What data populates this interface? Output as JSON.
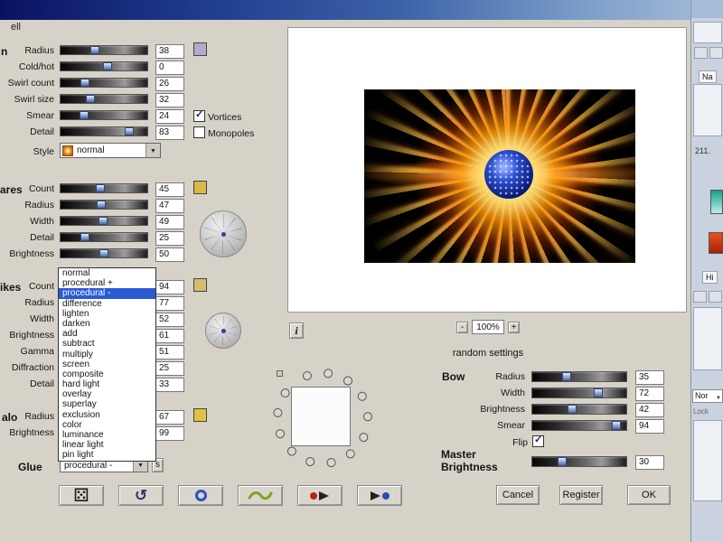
{
  "window": {
    "title_fragment": "ell"
  },
  "sun": {
    "section_label": "n",
    "rows": [
      {
        "label": "Radius",
        "value": 38
      },
      {
        "label": "Cold/hot",
        "value": 0,
        "pos": 55
      },
      {
        "label": "Swirl count",
        "value": 26
      },
      {
        "label": "Swirl size",
        "value": 32
      },
      {
        "label": "Smear",
        "value": 24
      },
      {
        "label": "Detail",
        "value": 83
      }
    ],
    "vortices": {
      "label": "Vortices",
      "checked": true
    },
    "monopoles": {
      "label": "Monopoles",
      "checked": false
    },
    "style": {
      "label": "Style",
      "value": "normal"
    }
  },
  "flares": {
    "section_label": "ares",
    "rows": [
      {
        "label": "Count",
        "value": 45
      },
      {
        "label": "Radius",
        "value": 47
      },
      {
        "label": "Width",
        "value": 49
      },
      {
        "label": "Detail",
        "value": 25
      },
      {
        "label": "Brightness",
        "value": 50
      }
    ]
  },
  "spikes": {
    "section_label": "ikes",
    "rows": [
      {
        "label": "Count",
        "value": 94
      },
      {
        "label": "Radius",
        "value": 77
      },
      {
        "label": "Width",
        "value": 52
      },
      {
        "label": "Brightness",
        "value": 61
      },
      {
        "label": "Gamma",
        "value": 51
      },
      {
        "label": "Diffraction",
        "value": 25
      },
      {
        "label": "Detail",
        "value": 33
      }
    ]
  },
  "halo": {
    "section_label": "alo",
    "rows": [
      {
        "label": "Radius",
        "value": 67
      },
      {
        "label": "Brightness",
        "value": 99
      }
    ]
  },
  "glue": {
    "label": "Glue",
    "value": "procedural -",
    "s_button_label": "s"
  },
  "blend_menu": {
    "items": [
      "normal",
      "procedural +",
      "procedural -",
      "difference",
      "lighten",
      "darken",
      "add",
      "subtract",
      "multiply",
      "screen",
      "composite",
      "hard light",
      "overlay",
      "superlay",
      "exclusion",
      "color",
      "luminance",
      "linear light",
      "pin light"
    ],
    "selected": "procedural -"
  },
  "preview": {
    "info_label": "i",
    "zoom_out_label": "-",
    "zoom_value": "100%",
    "zoom_in_label": "+",
    "random_label": "random settings"
  },
  "bow": {
    "section_label": "Bow",
    "rows": [
      {
        "label": "Radius",
        "value": 35
      },
      {
        "label": "Width",
        "value": 72
      },
      {
        "label": "Brightness",
        "value": 42
      },
      {
        "label": "Smear",
        "value": 94
      }
    ],
    "flip": {
      "label": "Flip",
      "checked": true
    }
  },
  "master": {
    "label_line1": "Master",
    "label_line2": "Brightness",
    "value": 30
  },
  "footer": {
    "cancel_label": "Cancel",
    "register_label": "Register",
    "ok_label": "OK"
  },
  "side_panel": {
    "nav_tab": "Na",
    "reading": "211.",
    "history_tab": "Hi",
    "blend_value": "Nor",
    "lock_label": "Lock"
  },
  "colors": {
    "dialog_bg": "#d6d2c8",
    "titlebar_blue": "#1e3a8c",
    "menu_selection": "#2a5ad4",
    "sun_swatch": "#b2aac8",
    "flares_swatch": "#d8b945",
    "spikes_swatch": "#d6bd6e",
    "halo_swatch": "#e0c243"
  }
}
